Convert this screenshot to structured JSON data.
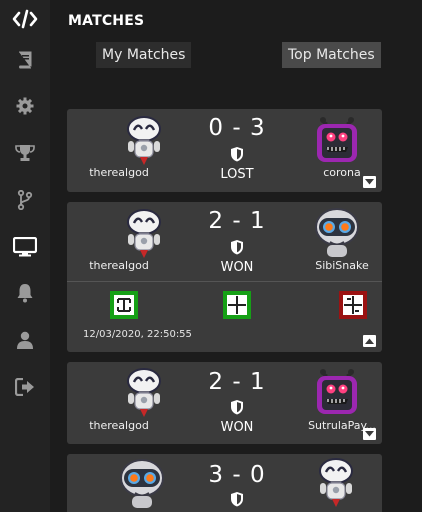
{
  "sidebar": {
    "items": [
      {
        "icon": "code-icon",
        "label": ""
      },
      {
        "icon": "book-icon",
        "label": ""
      },
      {
        "icon": "gear-icon",
        "label": ""
      },
      {
        "icon": "trophy-icon",
        "label": ""
      },
      {
        "icon": "branch-icon",
        "label": ""
      },
      {
        "icon": "monitor-icon",
        "label": "",
        "active": true
      },
      {
        "icon": "bell-icon",
        "label": ""
      },
      {
        "icon": "user-icon",
        "label": ""
      },
      {
        "icon": "logout-icon",
        "label": ""
      }
    ]
  },
  "header": {
    "title": "MATCHES",
    "tabs": [
      "My Matches",
      "Top Matches"
    ]
  },
  "matches": [
    {
      "player1": "therealgod",
      "player2": "corona",
      "score": "0 - 3",
      "result": "LOST",
      "p1_avatar": "white-robot",
      "p2_avatar": "purple-monster",
      "expanded": false
    },
    {
      "player1": "therealgod",
      "player2": "SibiSnake",
      "score": "2 - 1",
      "result": "WON",
      "p1_avatar": "white-robot",
      "p2_avatar": "grey-round-robot",
      "expanded": true,
      "timestamp": "12/03/2020, 22:50:55",
      "game_colors": [
        "#16a016",
        "#16a016",
        "#9b1212"
      ]
    },
    {
      "player1": "therealgod",
      "player2": "SutrulaPay...",
      "score": "2 - 1",
      "result": "WON",
      "p1_avatar": "white-robot",
      "p2_avatar": "purple-monster",
      "expanded": false
    },
    {
      "player1": "",
      "player2": "",
      "score": "3 - 0",
      "result": "",
      "p1_avatar": "grey-round-robot",
      "p2_avatar": "white-robot",
      "expanded": false
    }
  ],
  "colors": {
    "background": "#1c1c1c",
    "sidebar": "#232323",
    "card": "#3b3b3b",
    "won_game": "#16a016",
    "lost_game": "#9b1212"
  }
}
